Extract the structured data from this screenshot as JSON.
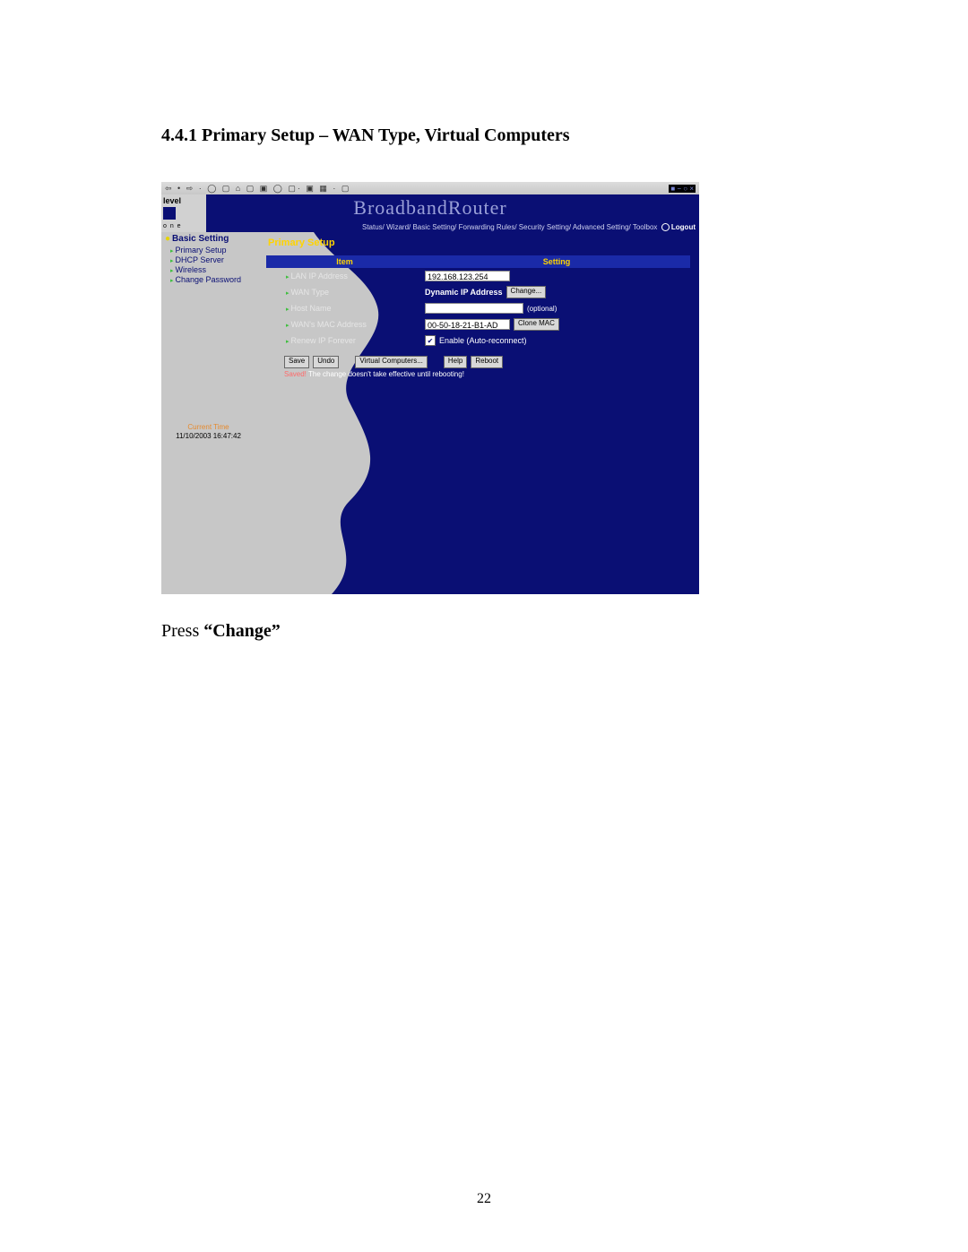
{
  "doc": {
    "heading": "4.4.1 Primary Setup – WAN Type, Virtual Computers",
    "caption_prefix": "Press ",
    "caption_bold": "“Change”",
    "page_number": "22"
  },
  "toolbar": {
    "icons_left": "⇦ • ⇨ · ◯ ▢ ⌂  ▢ ▣ ◯  ▢· ▣ ▦ · ▢",
    "right": "■  − ○ ×"
  },
  "banner": {
    "logo_line1": "level",
    "logo_bottom": "o n e",
    "title": "BroadbandRouter",
    "crumbs": [
      "Status",
      "Wizard",
      "Basic Setting",
      "Forwarding Rules",
      "Security Setting",
      "Advanced Setting",
      "Toolbox"
    ],
    "logout": "Logout"
  },
  "sidebar": {
    "section": "Basic Setting",
    "items": [
      "Primary Setup",
      "DHCP Server",
      "Wireless",
      "Change Password"
    ],
    "time_label": "Current Time",
    "time_value": "11/10/2003 16:47:42"
  },
  "content": {
    "title": "Primary Setup",
    "col_item": "Item",
    "col_setting": "Setting",
    "rows": {
      "lan_ip": {
        "label": "LAN IP Address",
        "value": "192.168.123.254"
      },
      "wan_type": {
        "label": "WAN Type",
        "dyn_label": "Dynamic IP Address",
        "change_btn": "Change..."
      },
      "host_name": {
        "label": "Host Name",
        "value": "",
        "optional": "(optional)"
      },
      "wan_mac": {
        "label": "WAN's MAC Address",
        "value": "00-50-18-21-B1-AD",
        "clone_btn": "Clone MAC"
      },
      "renew": {
        "label": "Renew IP Forever",
        "checked": "✔",
        "enable_text": "Enable (Auto-reconnect)"
      }
    },
    "buttons": {
      "save": "Save",
      "undo": "Undo",
      "virtual": "Virtual Computers...",
      "help": "Help",
      "reboot": "Reboot"
    },
    "note_warn": "Saved!",
    "note_text": " The change doesn't take effective until rebooting!"
  }
}
